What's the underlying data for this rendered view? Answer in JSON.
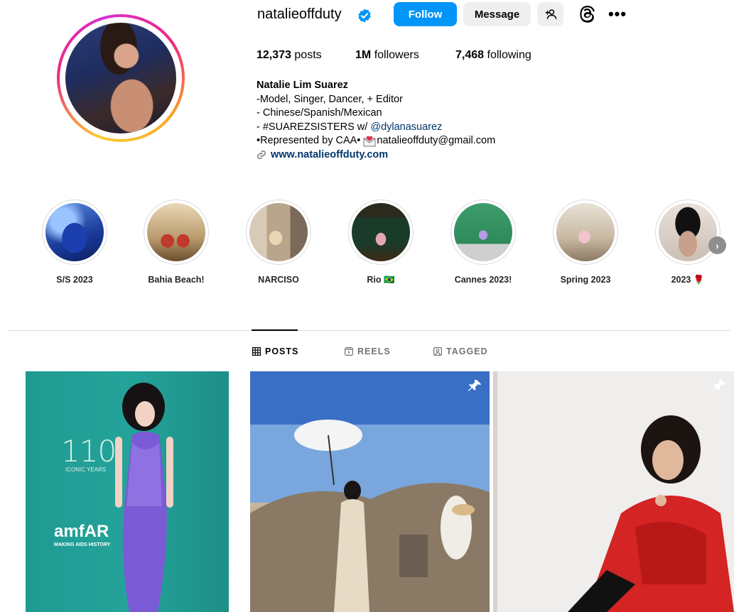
{
  "profile": {
    "username": "natalieoffduty",
    "follow_label": "Follow",
    "message_label": "Message",
    "posts_count": "12,373",
    "posts_label": "posts",
    "followers_count": "1M",
    "followers_label": "followers",
    "following_count": "7,468",
    "following_label": "following"
  },
  "bio": {
    "name": "Natalie Lim Suarez",
    "line1": "-Model, Singer, Dancer, + Editor",
    "line2": "- Chinese/Spanish/Mexican",
    "line3_prefix": "- #SUAREZSISTERS w/ ",
    "line3_mention": "@dylanasuarez",
    "line4_prefix": "•Represented by CAA• ",
    "line4_email": "natalieoffduty@gmail.com",
    "website": "www.natalieoffduty.com"
  },
  "highlights": [
    {
      "label": "S/S 2023"
    },
    {
      "label": "Bahia Beach!"
    },
    {
      "label": "NARCISO"
    },
    {
      "label": "Rio 🇧🇷"
    },
    {
      "label": "Cannes 2023!"
    },
    {
      "label": "Spring 2023"
    },
    {
      "label": "2023 🌹"
    }
  ],
  "tabs": {
    "posts": "POSTS",
    "reels": "REELS",
    "tagged": "TAGGED"
  },
  "posts": [
    {
      "overlay_main": "110",
      "overlay_sub": "ICONIC YEARS",
      "brand": "amfAR",
      "brand_sub": "MAKING AIDS HISTORY"
    },
    {},
    {}
  ],
  "colors": {
    "follow_button": "#0095f6",
    "secondary_button": "#efefef",
    "link": "#00376b",
    "verified": "#0095f6"
  }
}
